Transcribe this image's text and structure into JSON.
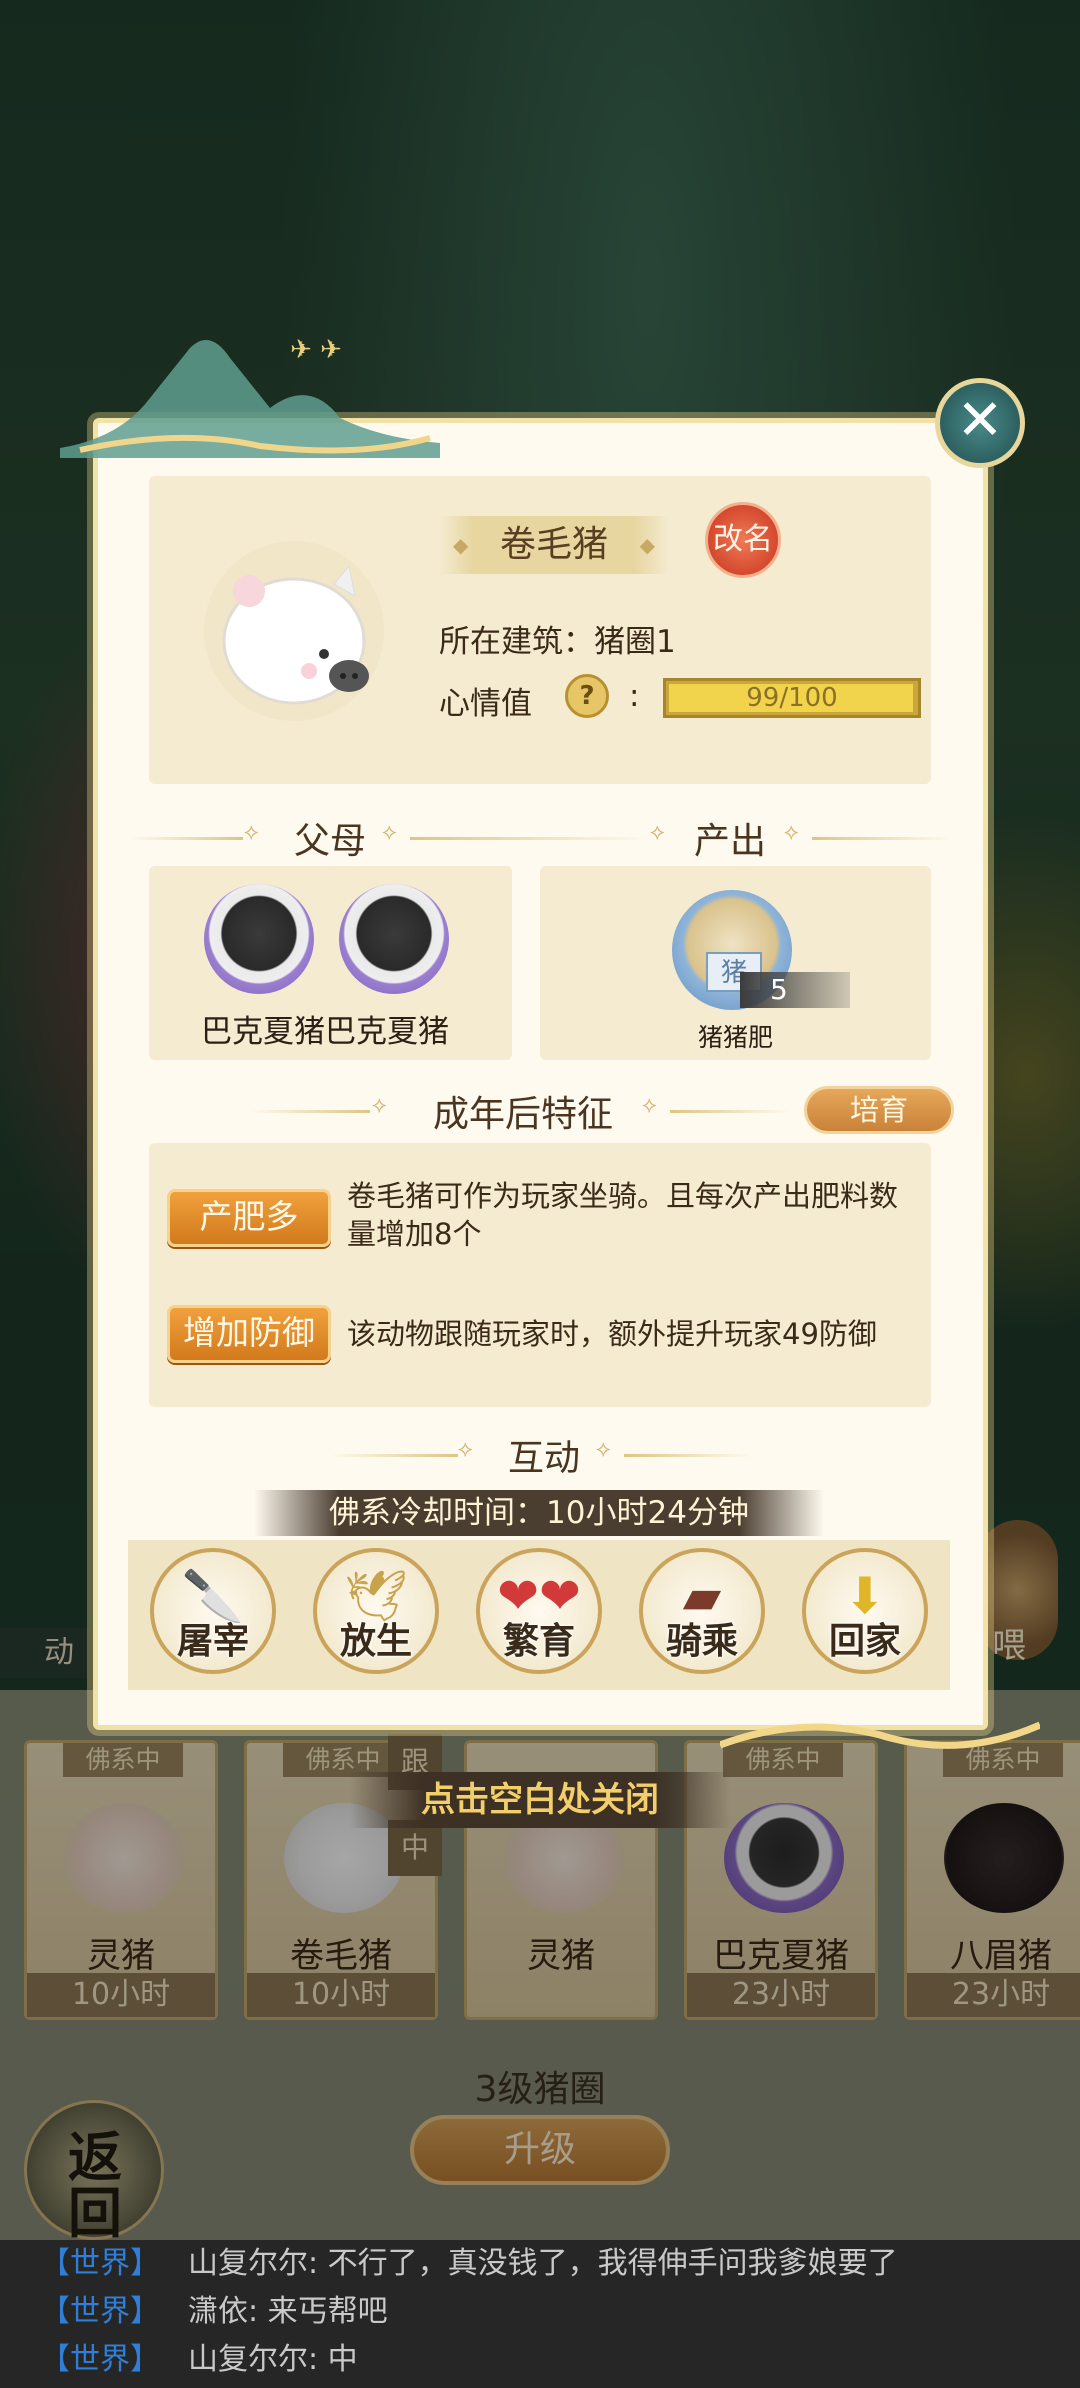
{
  "pig": {
    "name": "卷毛猪",
    "rename_label": "改名",
    "building_text": "所在建筑：猪圈1",
    "mood_label": "心情值",
    "mood_help": "?",
    "mood_colon": ":",
    "mood_text": "99/100",
    "mood_value": 99,
    "mood_max": 100
  },
  "sections": {
    "parents": "父母",
    "output": "产出",
    "adult_traits": "成年后特征",
    "interaction": "互动"
  },
  "parents": {
    "names_text": "巴克夏猪巴克夏猪"
  },
  "output": {
    "item_name": "猪猪肥",
    "item_label": "猪",
    "quantity": "5"
  },
  "cultivate_label": "培育",
  "traits": [
    {
      "tag": "产肥多",
      "desc": "卷毛猪可作为玩家坐骑。且每次产出肥料数量增加8个"
    },
    {
      "tag": "增加防御",
      "desc": "该动物跟随玩家时，额外提升玩家49防御"
    }
  ],
  "cooldown_text": "佛系冷却时间：10小时24分钟",
  "actions": [
    {
      "label": "屠宰",
      "icon": "cleaver-icon"
    },
    {
      "label": "放生",
      "icon": "bird-icon"
    },
    {
      "label": "繁育",
      "icon": "hearts-icon"
    },
    {
      "label": "骑乘",
      "icon": "saddle-icon"
    },
    {
      "label": "回家",
      "icon": "fence-home-icon"
    }
  ],
  "close_hint": "点击空白处关闭",
  "pen": {
    "animals": [
      {
        "status": "佛系中",
        "name": "灵猪",
        "time": "10小时"
      },
      {
        "status": "佛系中",
        "name": "卷毛猪",
        "time": "10小时"
      },
      {
        "status": "",
        "name": "灵猪",
        "time": ""
      },
      {
        "status": "佛系中",
        "name": "巴克夏猪",
        "time": "23小时"
      },
      {
        "status": "佛系中",
        "name": "八眉猪",
        "time": "23小时"
      }
    ],
    "follow_tag": "跟",
    "middle_tag": "中",
    "level_label": "3级猪圈",
    "upgrade_label": "升级",
    "left_side_label": "动",
    "right_side_label": "喂"
  },
  "back_label": "返回",
  "chat": [
    {
      "channel": "【世界】",
      "user": "山复尔尔",
      "message": ": 不行了，真没钱了，我得伸手问我爹娘要了"
    },
    {
      "channel": "【世界】",
      "user": "潇依",
      "message": ": 来丐帮吧"
    },
    {
      "channel": "【世界】",
      "user": "山复尔尔",
      "message": ": 中"
    }
  ],
  "colors": {
    "modal_bg": "#fffaf0",
    "card_bg": "#f4ebd1",
    "trait_orange": "#e3902b",
    "mood_yellow": "#f2d34c",
    "chat_channel": "#2f7fd8"
  }
}
